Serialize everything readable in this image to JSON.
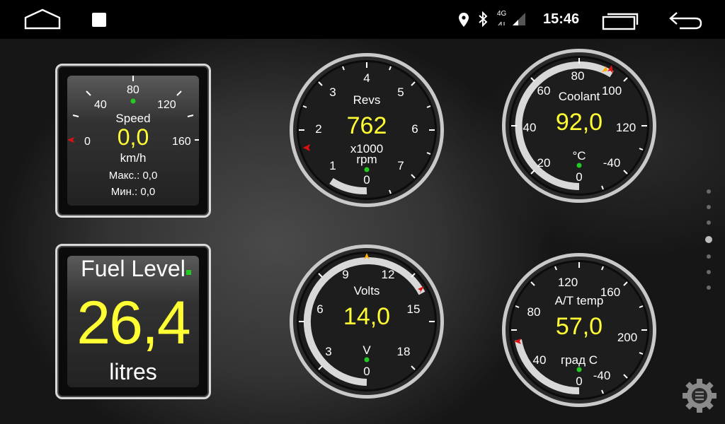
{
  "status_bar": {
    "time": "15:46",
    "network": "4G",
    "icons": [
      "home-icon",
      "recent-apps-square-icon",
      "location-pin-icon",
      "bluetooth-icon",
      "signal-icon",
      "multi-window-icon",
      "back-icon"
    ]
  },
  "speed": {
    "title": "Speed",
    "value": "0,0",
    "unit": "km/h",
    "max_text": "Макс.: 0,0",
    "min_text": "Мин.: 0,0",
    "ticks": [
      "0",
      "40",
      "80",
      "120",
      "160"
    ]
  },
  "revs": {
    "title": "Revs",
    "value": "762",
    "unit": "x1000",
    "unit2": "rpm",
    "zero": "0",
    "ticks": [
      "0",
      "1",
      "2",
      "3",
      "4",
      "5",
      "6",
      "7"
    ]
  },
  "coolant": {
    "title": "Coolant",
    "value": "92,0",
    "unit": "°C",
    "zero": "0",
    "ticks": [
      "-40",
      "20",
      "40",
      "60",
      "80",
      "100",
      "120"
    ]
  },
  "fuel": {
    "title": "Fuel Level",
    "value": "26,4",
    "unit": "litres"
  },
  "volts": {
    "title": "Volts",
    "value": "14,0",
    "unit": "V",
    "zero": "0",
    "ticks": [
      "3",
      "6",
      "9",
      "12",
      "15",
      "18"
    ]
  },
  "at_temp": {
    "title": "A/T temp",
    "value": "57,0",
    "unit": "град С",
    "zero": "0",
    "ticks": [
      "-40",
      "40",
      "80",
      "120",
      "160",
      "200"
    ]
  },
  "colors": {
    "value_yellow": "#ffff33",
    "indicator_green": "#22cc22",
    "marker_red": "#e01010",
    "marker_orange": "#ffaa00"
  },
  "pager": {
    "count": 7,
    "active_index": 3
  }
}
